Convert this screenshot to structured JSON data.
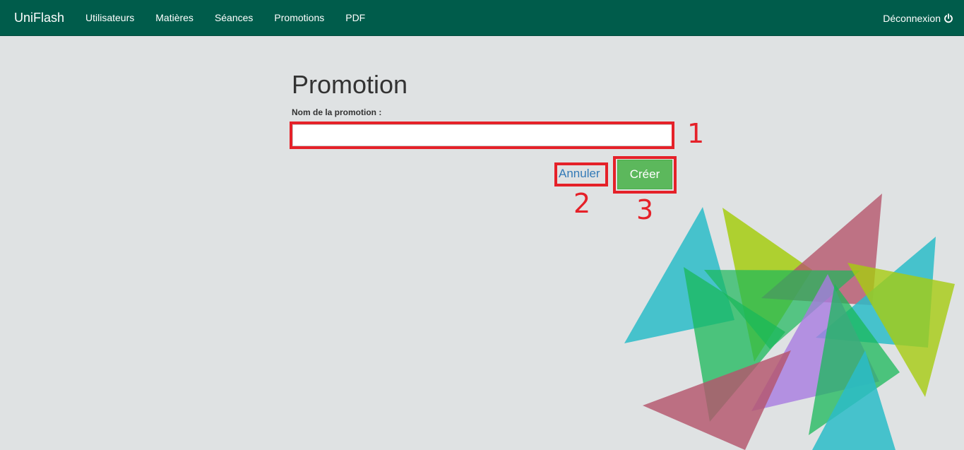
{
  "navbar": {
    "brand": "UniFlash",
    "items": [
      {
        "label": "Utilisateurs"
      },
      {
        "label": "Matières"
      },
      {
        "label": "Séances"
      },
      {
        "label": "Promotions"
      },
      {
        "label": "PDF"
      }
    ],
    "logout_label": "Déconnexion",
    "logout_icon": "power-icon"
  },
  "form": {
    "title": "Promotion",
    "name_label": "Nom de la promotion :",
    "name_value": "",
    "cancel_label": "Annuler",
    "create_label": "Créer"
  },
  "annotations": {
    "color": "#e52129",
    "labels": [
      "1",
      "2",
      "3"
    ]
  },
  "colors": {
    "navbar": "#005c4b",
    "background": "#dfe2e3",
    "create_button": "#5cb85c",
    "link": "#337ab7"
  }
}
